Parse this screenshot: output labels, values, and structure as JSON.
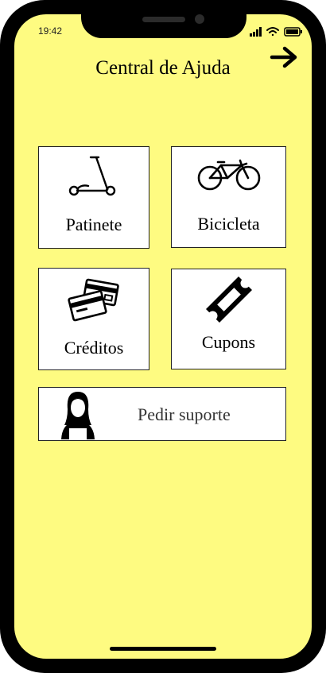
{
  "status_bar": {
    "time": "19:42",
    "icons": [
      "cellular-signal-icon",
      "wifi-icon",
      "battery-icon"
    ]
  },
  "header": {
    "title": "Central de Ajuda",
    "back_icon": "arrow-right-icon"
  },
  "categories": [
    {
      "label": "Patinete",
      "icon": "kick-scooter-icon"
    },
    {
      "label": "Bicicleta",
      "icon": "bicycle-icon"
    },
    {
      "label": "Créditos",
      "icon": "credit-cards-icon"
    },
    {
      "label": "Cupons",
      "icon": "ticket-icon"
    }
  ],
  "support": {
    "label": "Pedir suporte",
    "icon": "support-agent-icon"
  },
  "colors": {
    "screen_background": "#fefb81",
    "phone_frame": "#000000",
    "tile_background": "#ffffff"
  }
}
